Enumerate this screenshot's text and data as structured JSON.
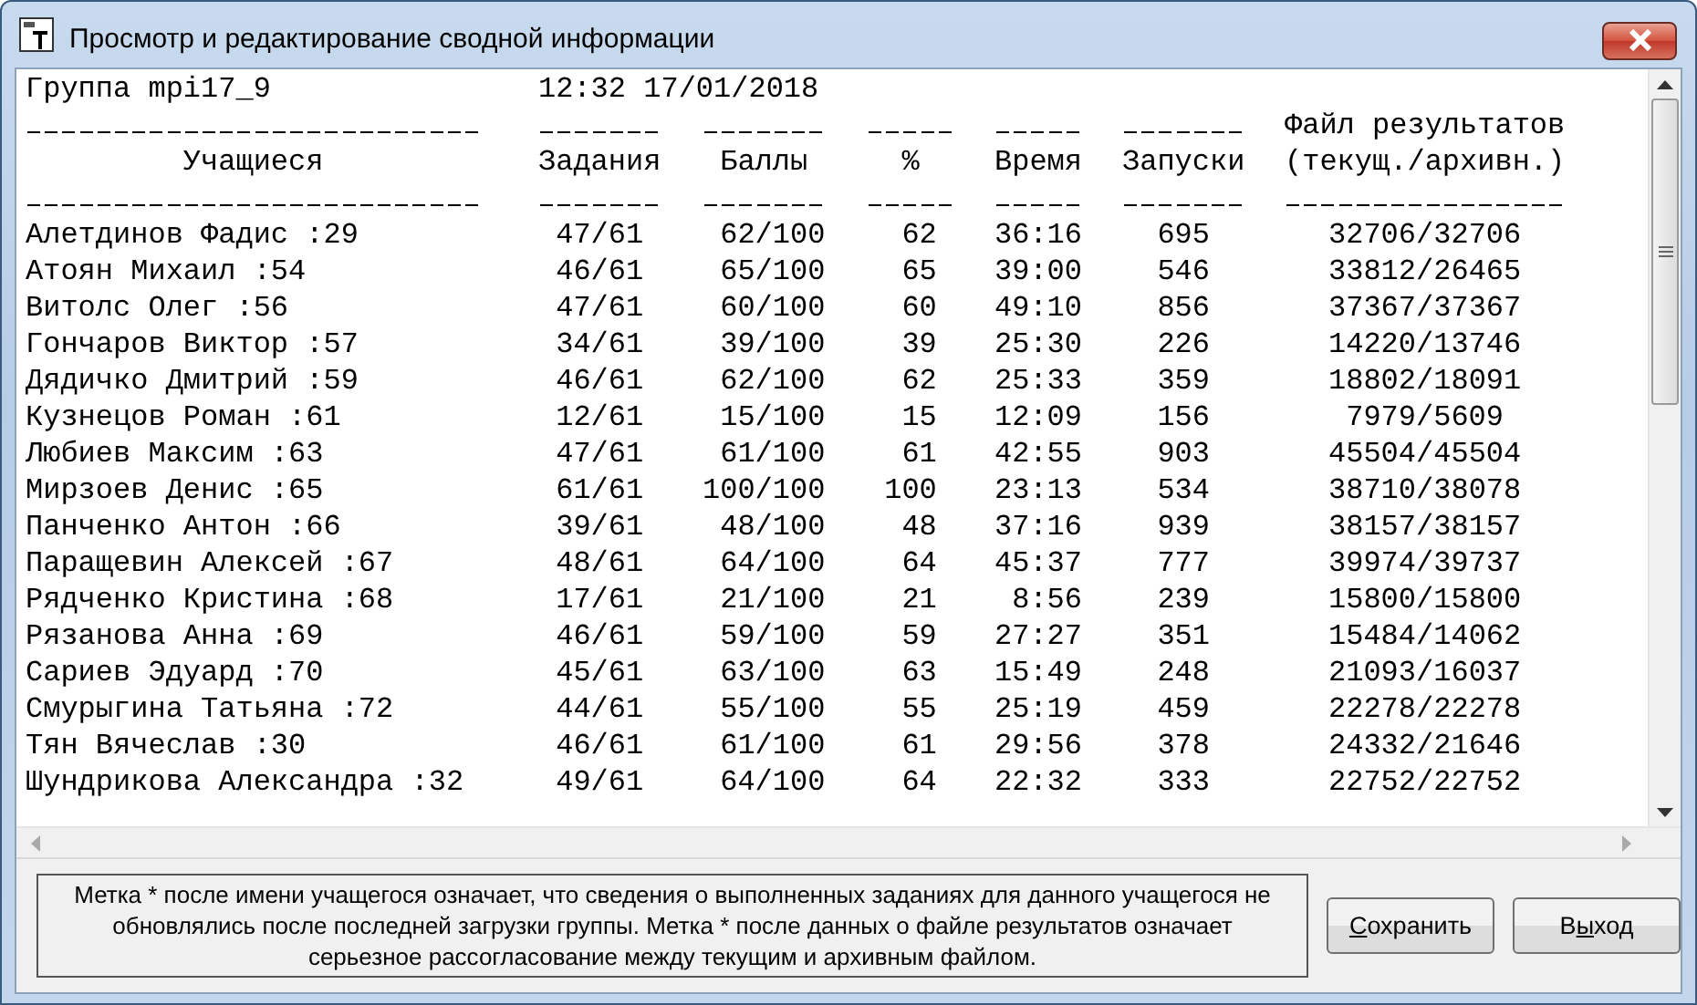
{
  "window": {
    "title": "Просмотр и редактирование сводной информации"
  },
  "report": {
    "group": "Группа mpi17_9",
    "timestamp": "12:32 17/01/2018",
    "columns": [
      {
        "label": "Учащиеся",
        "kind": "name"
      },
      {
        "label": "Задания",
        "kind": "tasks"
      },
      {
        "label": "Баллы",
        "kind": "score"
      },
      {
        "label": "%",
        "kind": "percent"
      },
      {
        "label": "Время",
        "kind": "time"
      },
      {
        "label": "Запуски",
        "kind": "runs"
      },
      {
        "label": "(текущ./архивн.)",
        "caption": "Файл результатов",
        "kind": "file"
      }
    ],
    "rows": [
      [
        "Алетдинов Фадис :29",
        "47/61",
        "62/100",
        "62",
        "36:16",
        "695",
        "32706/32706"
      ],
      [
        "Атоян Михаил :54",
        "46/61",
        "65/100",
        "65",
        "39:00",
        "546",
        "33812/26465"
      ],
      [
        "Витолс Олег :56",
        "47/61",
        "60/100",
        "60",
        "49:10",
        "856",
        "37367/37367"
      ],
      [
        "Гончаров Виктор :57",
        "34/61",
        "39/100",
        "39",
        "25:30",
        "226",
        "14220/13746"
      ],
      [
        "Дядичко Дмитрий :59",
        "46/61",
        "62/100",
        "62",
        "25:33",
        "359",
        "18802/18091"
      ],
      [
        "Кузнецов Роман :61",
        "12/61",
        "15/100",
        "15",
        "12:09",
        "156",
        "7979/5609"
      ],
      [
        "Любиев Максим :63",
        "47/61",
        "61/100",
        "61",
        "42:55",
        "903",
        "45504/45504"
      ],
      [
        "Мирзоев Денис :65",
        "61/61",
        "100/100",
        "100",
        "23:13",
        "534",
        "38710/38078"
      ],
      [
        "Панченко Антон :66",
        "39/61",
        "48/100",
        "48",
        "37:16",
        "939",
        "38157/38157"
      ],
      [
        "Паращевин Алексей :67",
        "48/61",
        "64/100",
        "64",
        "45:37",
        "777",
        "39974/39737"
      ],
      [
        "Рядченко Кристина :68",
        "17/61",
        "21/100",
        "21",
        "8:56",
        "239",
        "15800/15800"
      ],
      [
        "Рязанова Анна :69",
        "46/61",
        "59/100",
        "59",
        "27:27",
        "351",
        "15484/14062"
      ],
      [
        "Сариев Эдуард :70",
        "45/61",
        "63/100",
        "63",
        "15:49",
        "248",
        "21093/16037"
      ],
      [
        "Смурыгина Татьяна :72",
        "44/61",
        "55/100",
        "55",
        "25:19",
        "459",
        "22278/22278"
      ],
      [
        "Тян Вячеслав :30",
        "46/61",
        "61/100",
        "61",
        "29:56",
        "378",
        "24332/21646"
      ],
      [
        "Шундрикова Александра :32",
        "49/61",
        "64/100",
        "64",
        "22:32",
        "333",
        "22752/22752"
      ]
    ]
  },
  "note": "Метка * после имени учащегося означает, что сведения о выполненных заданиях для данного учащегося не обновлялись после последней загрузки группы. Метка * после данных о файле результатов означает серьезное рассогласование между текущим и архивным файлом.",
  "buttons": [
    {
      "parts": [
        {
          "text": "С",
          "underlined": true
        },
        {
          "text": "охранить",
          "underlined": false
        }
      ]
    },
    {
      "parts": [
        {
          "text": "В",
          "underlined": false
        },
        {
          "text": "ы",
          "underlined": true
        },
        {
          "text": "ход",
          "underlined": false
        }
      ]
    }
  ]
}
